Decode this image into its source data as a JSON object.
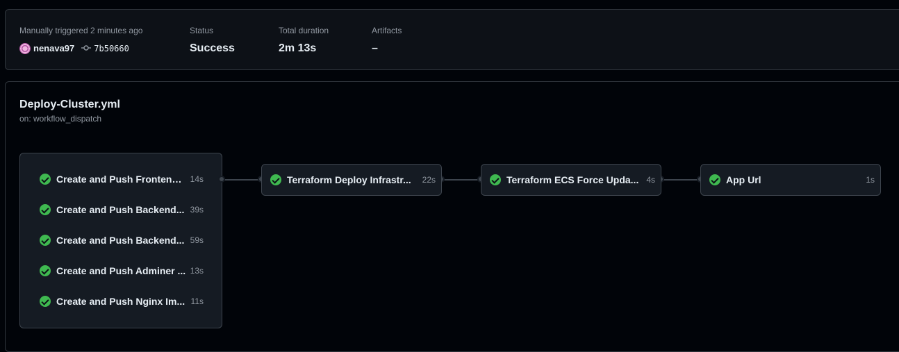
{
  "summary": {
    "trigger_label": "Manually triggered 2 minutes ago",
    "actor": "nenava97",
    "commit_sha": "7b50660",
    "status_label": "Status",
    "status_value": "Success",
    "duration_label": "Total duration",
    "duration_value": "2m 13s",
    "artifacts_label": "Artifacts",
    "artifacts_value": "–"
  },
  "workflow": {
    "name": "Deploy-Cluster.yml",
    "trigger": "on: workflow_dispatch"
  },
  "group_jobs": [
    {
      "name": "Create and Push Frontend...",
      "duration": "14s"
    },
    {
      "name": "Create and Push Backend...",
      "duration": "39s"
    },
    {
      "name": "Create and Push Backend...",
      "duration": "59s"
    },
    {
      "name": "Create and Push Adminer ...",
      "duration": "13s"
    },
    {
      "name": "Create and Push Nginx Im...",
      "duration": "11s"
    }
  ],
  "jobs": [
    {
      "name": "Terraform Deploy Infrastr...",
      "duration": "22s"
    },
    {
      "name": "Terraform ECS Force Upda...",
      "duration": "4s"
    },
    {
      "name": "App Url",
      "duration": "1s"
    }
  ],
  "colors": {
    "success": "#3fb950",
    "background": "#010409",
    "panel": "#0d1117",
    "border": "#30363d"
  },
  "icons": [
    "avatar",
    "commit-icon",
    "check-circle-icon"
  ]
}
